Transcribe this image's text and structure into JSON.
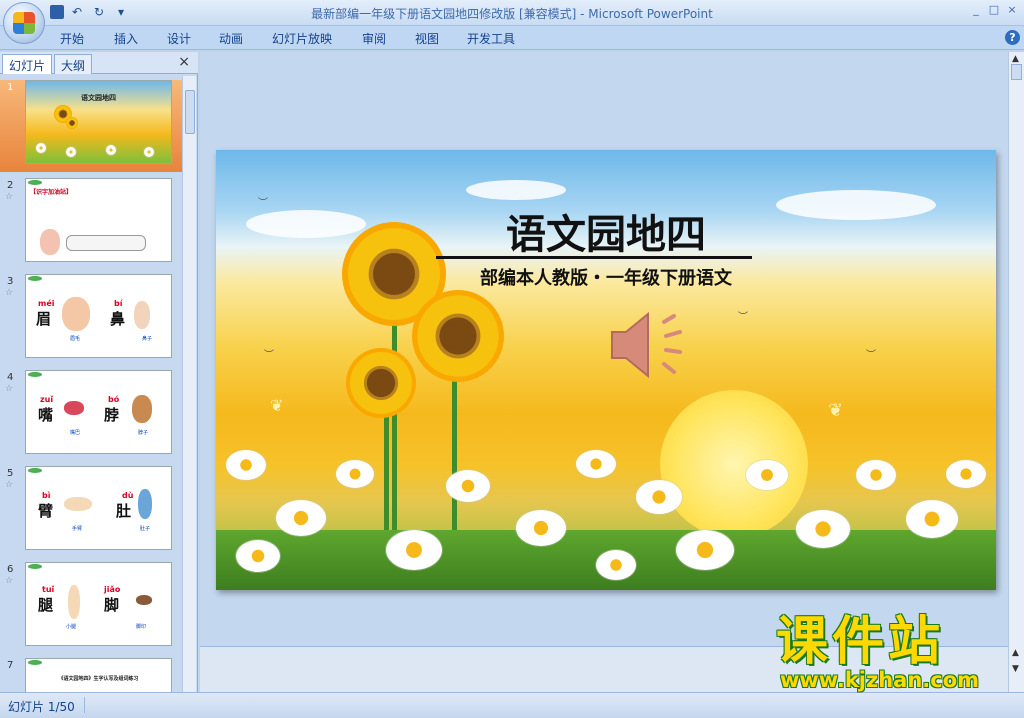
{
  "window": {
    "title": "最新部编一年级下册语文园地四修改版 [兼容模式] - Microsoft PowerPoint",
    "controls": [
      "_",
      "□",
      "×"
    ]
  },
  "qat": {
    "undo": "↶",
    "redo": "↻",
    "more": "▾"
  },
  "ribbon": {
    "tabs": [
      "开始",
      "插入",
      "设计",
      "动画",
      "幻灯片放映",
      "审阅",
      "视图",
      "开发工具"
    ],
    "help": "?"
  },
  "panel": {
    "tab_slides": "幻灯片",
    "tab_outline": "大纲",
    "close": "×",
    "slides": [
      {
        "num": "1",
        "title": "语文园地四"
      },
      {
        "num": "2",
        "title": "【识字加油站】",
        "star": "☆"
      },
      {
        "num": "3",
        "pinyin": [
          "méi",
          "bí"
        ],
        "chars": [
          "眉",
          "鼻"
        ],
        "captions": [
          "眉毛",
          "鼻子"
        ],
        "star": "☆"
      },
      {
        "num": "4",
        "pinyin": [
          "zuǐ",
          "bó"
        ],
        "chars": [
          "嘴",
          "脖"
        ],
        "captions": [
          "嘴巴",
          "脖子"
        ],
        "star": "☆"
      },
      {
        "num": "5",
        "pinyin": [
          "bì",
          "dù"
        ],
        "chars": [
          "臂",
          "肚"
        ],
        "captions": [
          "手臂",
          "肚子"
        ],
        "star": "☆"
      },
      {
        "num": "6",
        "pinyin": [
          "tuǐ",
          "jiǎo"
        ],
        "chars": [
          "腿",
          "脚"
        ],
        "captions": [
          "小腿",
          "脚印"
        ],
        "star": "☆"
      },
      {
        "num": "7",
        "title": "《语文园地四》生字认写及组词练习"
      }
    ]
  },
  "slide": {
    "title": "语文园地四",
    "subtitle": "部编本人教版・一年级下册语文"
  },
  "status": {
    "slide_indicator": "幻灯片 1/50"
  },
  "watermark": {
    "brand": "课件站",
    "url": "www.kjzhan.com"
  },
  "colors": {
    "accent": "#15428b",
    "selected_thumb": "#e8843c",
    "watermark": "#ffd800"
  }
}
